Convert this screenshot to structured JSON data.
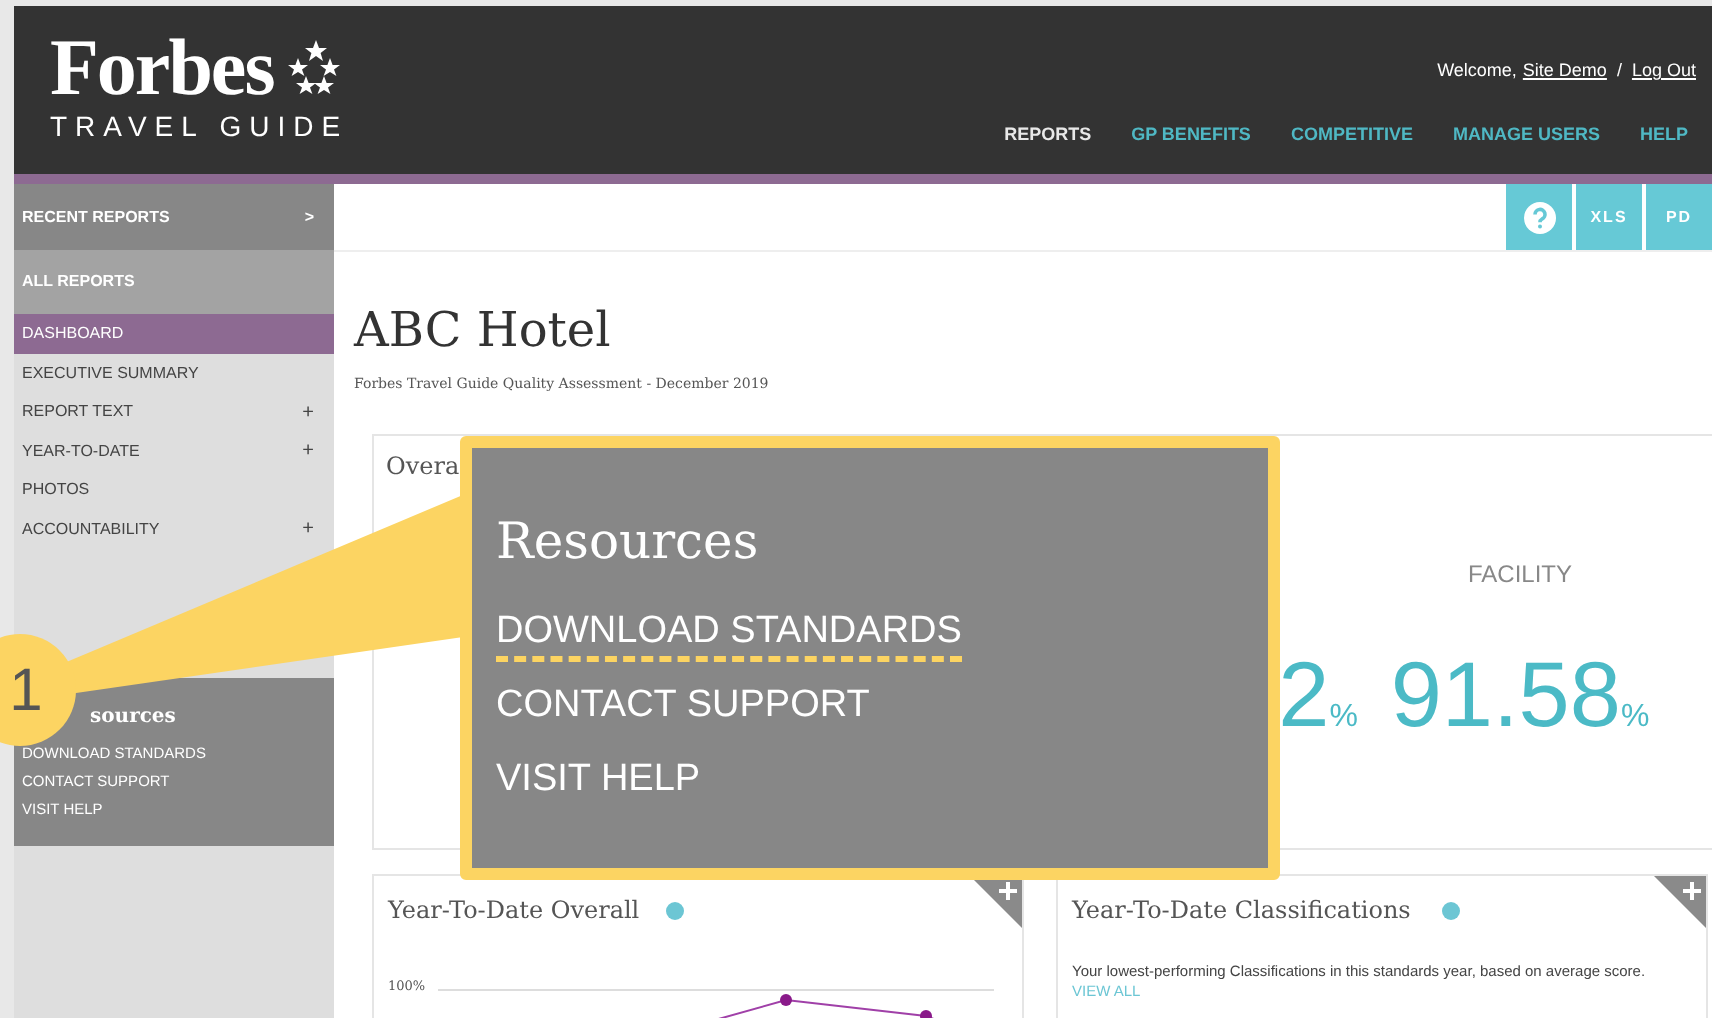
{
  "header": {
    "brand": "Forbes",
    "tagline": "TRAVEL GUIDE",
    "welcome": "Welcome,",
    "user": "Site Demo",
    "separator": "/",
    "logout": "Log Out",
    "nav": [
      {
        "label": "REPORTS",
        "selected": true
      },
      {
        "label": "GP BENEFITS",
        "selected": false
      },
      {
        "label": "COMPETITIVE",
        "selected": false
      },
      {
        "label": "MANAGE USERS",
        "selected": false
      },
      {
        "label": "HELP",
        "selected": false
      }
    ]
  },
  "sidebar": {
    "recent_reports": {
      "label": "RECENT REPORTS",
      "arrow": ">"
    },
    "all_reports": "ALL REPORTS",
    "items": [
      {
        "label": "DASHBOARD",
        "selected": true
      },
      {
        "label": "EXECUTIVE SUMMARY",
        "selected": false
      },
      {
        "label": "REPORT TEXT",
        "selected": false,
        "expander": "+"
      },
      {
        "label": "YEAR-TO-DATE",
        "selected": false,
        "expander": "+"
      },
      {
        "label": "PHOTOS",
        "selected": false
      },
      {
        "label": "ACCOUNTABILITY",
        "selected": false,
        "expander": "+"
      }
    ],
    "resources": {
      "title": "sources",
      "links": [
        "DOWNLOAD STANDARDS",
        "CONTACT SUPPORT",
        "VISIT HELP"
      ]
    }
  },
  "toolbar": {
    "buttons": [
      {
        "kind": "help"
      },
      {
        "kind": "text",
        "label": "XLS"
      },
      {
        "kind": "text",
        "label": "PD"
      }
    ]
  },
  "title": "ABC Hotel",
  "subtitle": "Forbes Travel Guide Quality Assessment - December 2019",
  "overall": {
    "title": "Overa",
    "metrics": [
      {
        "value": "2",
        "unit": "%"
      },
      {
        "label": "FACILITY",
        "value": "91.58",
        "unit": "%"
      }
    ]
  },
  "cards": [
    {
      "kind": "chart",
      "title": "Year-To-Date Overall",
      "tick": "100%"
    },
    {
      "kind": "text",
      "title": "Year-To-Date Classifications",
      "description": "Your lowest-performing Classifications in this standards year, based on average score.",
      "link": "VIEW ALL"
    }
  ],
  "callout": {
    "number": "1",
    "title": "Resources",
    "links": [
      {
        "label": "DOWNLOAD STANDARDS",
        "highlighted": true
      },
      {
        "label": "CONTACT SUPPORT",
        "highlighted": false
      },
      {
        "label": "VISIT HELP",
        "highlighted": false
      }
    ]
  }
}
